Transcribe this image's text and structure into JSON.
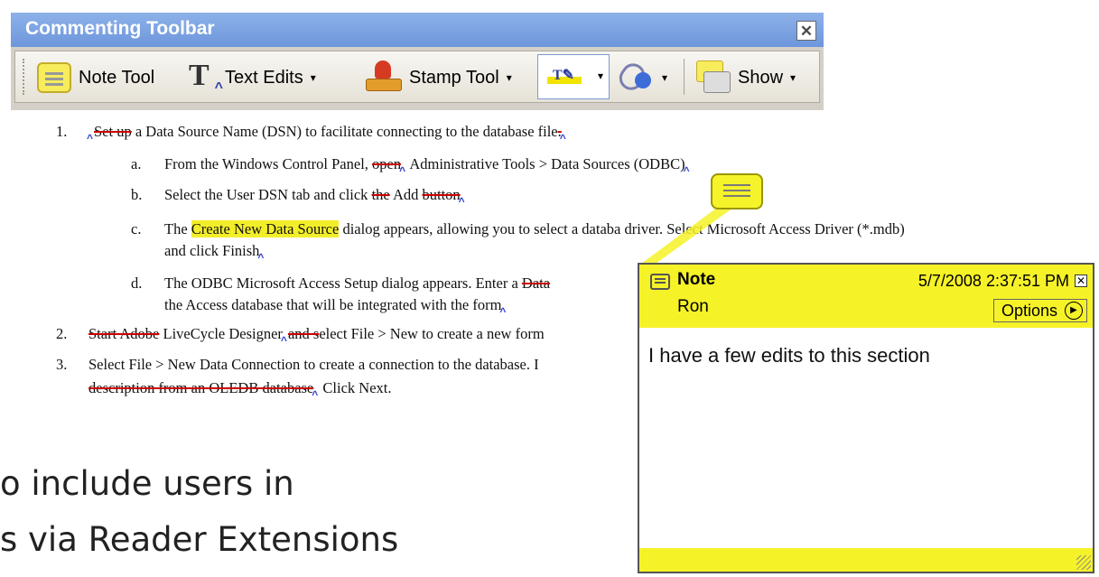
{
  "toolbar": {
    "title": "Commenting Toolbar",
    "close_glyph": "✕",
    "note_tool": "Note Tool",
    "text_edits": "Text Edits",
    "stamp_tool": "Stamp Tool",
    "show": "Show",
    "dropdown_glyph": "▾"
  },
  "doc": {
    "l1_num": "1.",
    "l1_del": "Set up",
    "l1_text": " a Data Source Name (DSN) to facilitate connecting to the database file",
    "l1_del2": ".",
    "la_num": "a.",
    "la_text1": "From the Windows Control Panel, ",
    "la_del": "open",
    "la_text2": " Administrative Tools > Data Sources (ODBC)",
    "lb_num": "b.",
    "lb_text1": "Select the User DSN tab and click ",
    "lb_del": "the",
    "lb_text2": " Add ",
    "lb_del2": "button",
    "lc_num": "c.",
    "lc_text1": "The ",
    "lc_hl": "Create New Data Source",
    "lc_text2": " dialog appears, allowing you to select a databa",
    "lc_text3": " driver.  Select Microsoft Access Driver (*.mdb)",
    "lc2_text": "and click Finish",
    "ld_num": "d.",
    "ld_text1": " The ODBC Microsoft Access Setup dialog appears.  Enter a ",
    "ld_del": "Data",
    "ld2_text": "the Access database that will be integrated with the form",
    "l2_num": "2.",
    "l2_del1": "Start Adobe",
    "l2_text1": " LiveCycle Designer",
    "l2_del2": "and s",
    "l2_text2": "elect File > New to create a new form",
    "l3_num": "3.",
    "l3_text": "Select File > New Data Connection to create a connection to the database.  I",
    "l32_del": "description from an OLEDB database",
    "l32_text": "  Click Next.",
    "caret_glyph": "^"
  },
  "slide": {
    "line1": "o include users in",
    "line2": "s via Reader Extensions"
  },
  "popup": {
    "title": "Note",
    "author": "Ron",
    "date": "5/7/2008 2:37:51 PM",
    "close_glyph": "✕",
    "options": "Options",
    "options_glyph": "▶",
    "body": "I have a few edits to this section"
  }
}
